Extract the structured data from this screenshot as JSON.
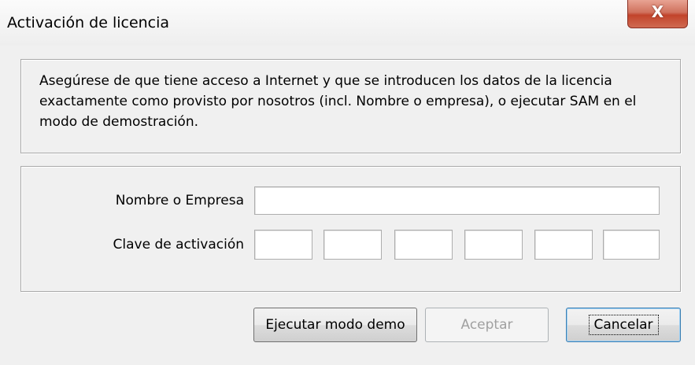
{
  "window": {
    "title": "Activación de licencia",
    "close_glyph": "X"
  },
  "info": {
    "text": "Asegúrese de que tiene acceso a Internet y que se introducen los datos de la licencia exactamente como provisto por nosotros (incl. Nombre o empresa), o ejecutar SAM en el modo de demostración."
  },
  "form": {
    "name_label": "Nombre o Empresa",
    "name_value": "",
    "key_label": "Clave de activación",
    "key_segments": [
      "",
      "",
      "",
      "",
      "",
      ""
    ]
  },
  "buttons": {
    "demo": "Ejecutar modo demo",
    "accept": "Aceptar",
    "cancel": "Cancelar"
  }
}
